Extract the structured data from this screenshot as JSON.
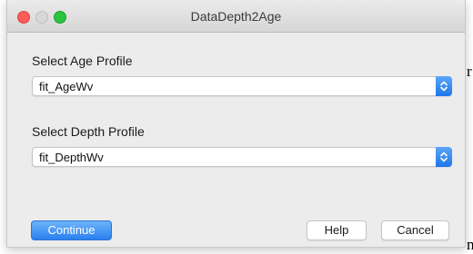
{
  "window": {
    "title": "DataDepth2Age"
  },
  "background": {
    "fragment_right": "r",
    "fragment_bottom": "n"
  },
  "age_profile": {
    "label": "Select Age Profile",
    "value": "fit_AgeWv"
  },
  "depth_profile": {
    "label": "Select Depth Profile",
    "value": "fit_DepthWv"
  },
  "buttons": {
    "continue": "Continue",
    "help": "Help",
    "cancel": "Cancel"
  },
  "colors": {
    "accent": "#2a80ef",
    "close": "#fc5d58",
    "maximize": "#2ac43f",
    "window_bg": "#ececec"
  }
}
